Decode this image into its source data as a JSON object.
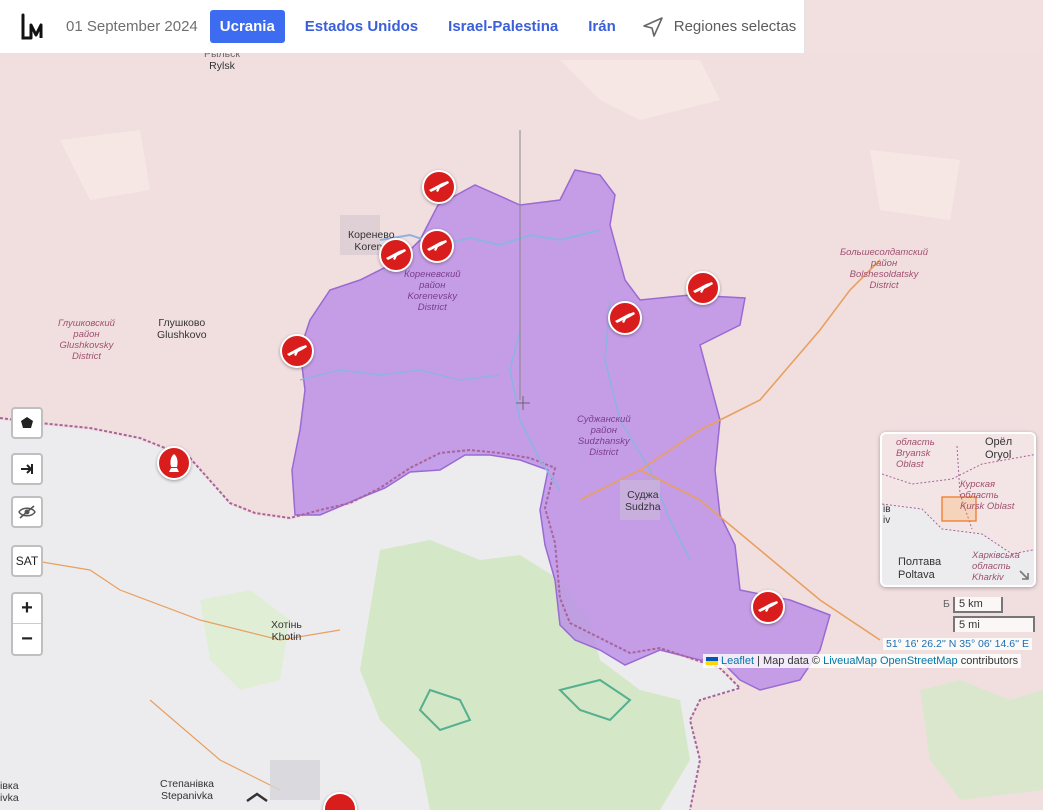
{
  "header": {
    "date": "01 September 2024",
    "tabs": [
      {
        "label": "Ucrania",
        "active": true
      },
      {
        "label": "Estados Unidos",
        "active": false
      },
      {
        "label": "Israel-Palestina",
        "active": false
      },
      {
        "label": "Irán",
        "active": false
      }
    ],
    "regions_label": "Regiones selectas"
  },
  "map": {
    "places": {
      "rylsk": "Rylsk",
      "rylsk_cyr": "Рыльск",
      "korenevo_cyr": "Коренево",
      "korenevo": "Korene",
      "glushkovo_cyr": "Глушково",
      "glushkovo": "Glushkovo",
      "sudzha_cyr": "Суджа",
      "sudzha": "Sudzha",
      "khotin_cyr": "Хотінь",
      "khotin": "Khotin",
      "stepanivka_cyr": "Степанівка",
      "stepanivka": "Stepanivka",
      "ivka": "івка",
      "ivka2": "ivka"
    },
    "districts": {
      "glushkovsky": [
        "Глушковский",
        "район",
        "Glushkovsky",
        "District"
      ],
      "korenevsky": [
        "Кореневский",
        "район",
        "Korenevsky",
        "District"
      ],
      "sudzhansky": [
        "Суджанский",
        "район",
        "Sudzhansky",
        "District"
      ],
      "bolshesoldatsky": [
        "Большесолдатский",
        "район",
        "Bolshesoldatsky",
        "District"
      ]
    },
    "markers": [
      {
        "type": "rifle",
        "name": "marker-north"
      },
      {
        "type": "rifle",
        "name": "marker-korenevo-1"
      },
      {
        "type": "rifle",
        "name": "marker-korenevo-2"
      },
      {
        "type": "rifle",
        "name": "marker-west"
      },
      {
        "type": "rifle",
        "name": "marker-center"
      },
      {
        "type": "rifle",
        "name": "marker-east"
      },
      {
        "type": "rifle",
        "name": "marker-southeast"
      },
      {
        "type": "bomb",
        "name": "marker-bomb"
      }
    ],
    "colors": {
      "russia": "#f1dfe0",
      "ukraine": "#ececee",
      "occupied": "#b98de8",
      "marker": "#d91c1c",
      "forest": "#cfe5c3"
    }
  },
  "controls": {
    "sat_label": "SAT",
    "zoom_in": "+",
    "zoom_out": "−"
  },
  "minimap": {
    "labels": {
      "bryansk_1": "область",
      "bryansk_2": "Bryansk",
      "bryansk_3": "Oblast",
      "oryol_cyr": "Орёл",
      "oryol": "Oryol",
      "kursk_1": "Курская",
      "kursk_2": "область",
      "kursk_3": "Kursk Oblast",
      "kiv": "ів",
      "kiv2": "iv",
      "poltava_cyr": "Полтава",
      "poltava": "Poltava",
      "kharkiv_1": "Харківська",
      "kharkiv_2": "область",
      "kharkiv_3": "Kharkiv"
    }
  },
  "scale": {
    "km": "5 km",
    "mi": "5 mi"
  },
  "coordinates": "51° 16' 26.2'' N 35° 06' 14.6'' E",
  "attribution": {
    "leaflet": "Leaflet",
    "separator": " | Map data © ",
    "liveuamap": "LiveuaMap",
    "osm": "OpenStreetMap",
    "contributors": " contributors"
  },
  "partial_label": "Б"
}
